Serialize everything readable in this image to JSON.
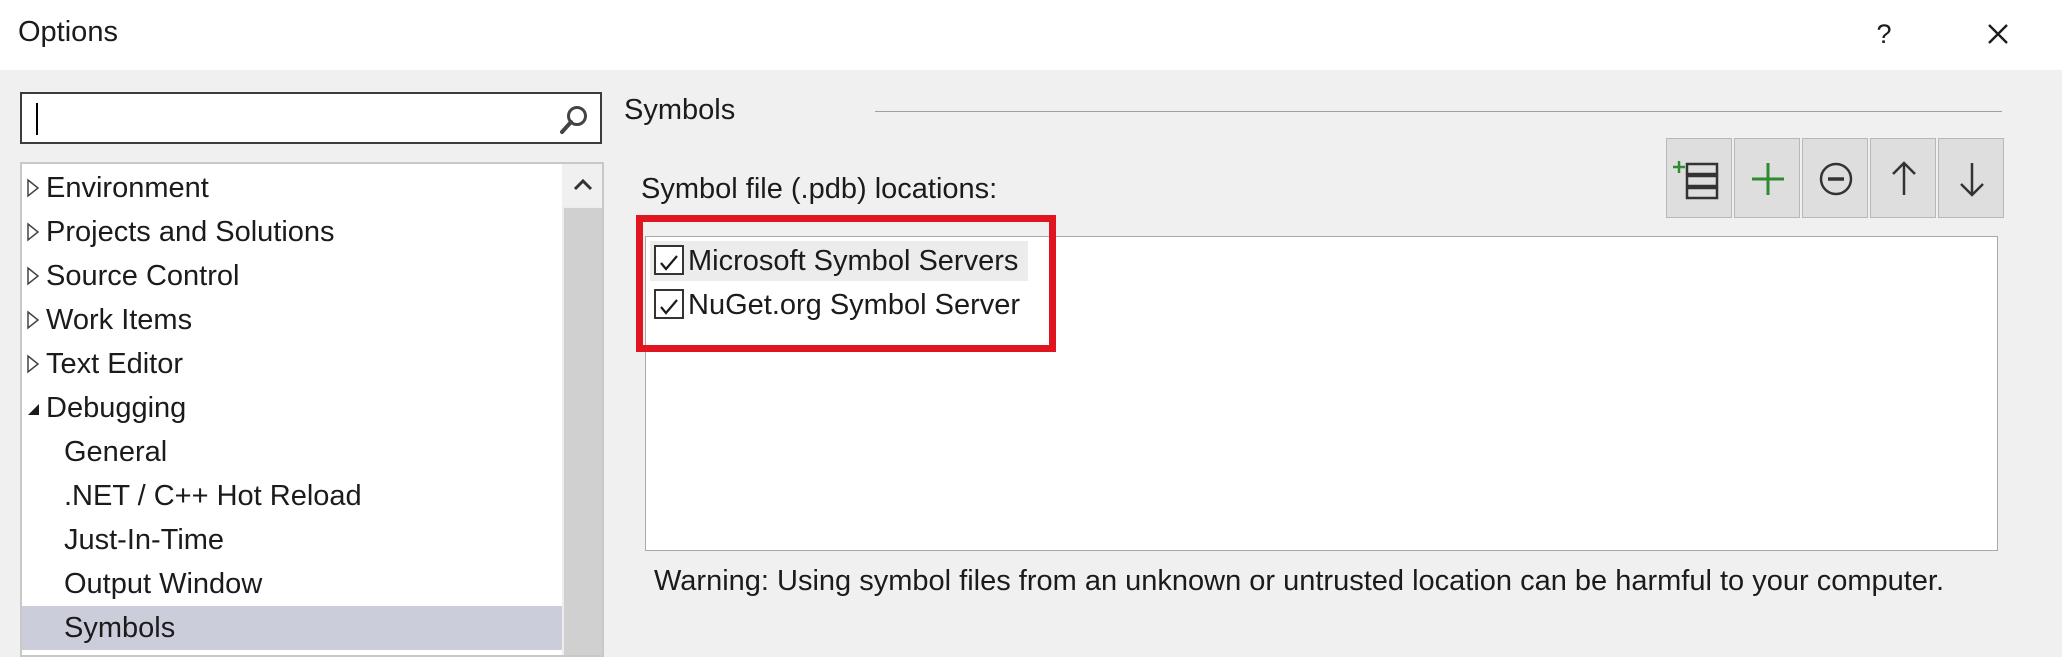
{
  "window": {
    "title": "Options",
    "help_label": "?"
  },
  "search": {
    "value": "",
    "placeholder": ""
  },
  "tree": {
    "items": [
      {
        "label": "Environment",
        "expander": "collapsed"
      },
      {
        "label": "Projects and Solutions",
        "expander": "collapsed"
      },
      {
        "label": "Source Control",
        "expander": "collapsed"
      },
      {
        "label": "Work Items",
        "expander": "collapsed"
      },
      {
        "label": "Text Editor",
        "expander": "collapsed"
      },
      {
        "label": "Debugging",
        "expander": "expanded"
      }
    ],
    "children": [
      {
        "label": "General"
      },
      {
        "label": ".NET / C++ Hot Reload"
      },
      {
        "label": "Just-In-Time"
      },
      {
        "label": "Output Window"
      },
      {
        "label": "Symbols",
        "selected": true
      }
    ]
  },
  "panel": {
    "title": "Symbols",
    "locations_label": "Symbol file (.pdb) locations:",
    "toolbar": [
      "load-all-symbols-icon",
      "add-icon",
      "remove-icon",
      "move-up-icon",
      "move-down-icon"
    ],
    "locations": [
      {
        "label": "Microsoft Symbol Servers",
        "checked": true
      },
      {
        "label": "NuGet.org Symbol Server",
        "checked": true
      }
    ],
    "warning": "Warning: Using symbol files from an unknown or untrusted location can be harmful to your computer."
  },
  "colors": {
    "highlight_border": "#e01520",
    "selection": "#cbcddb",
    "add_icon": "#2e8b2e"
  }
}
